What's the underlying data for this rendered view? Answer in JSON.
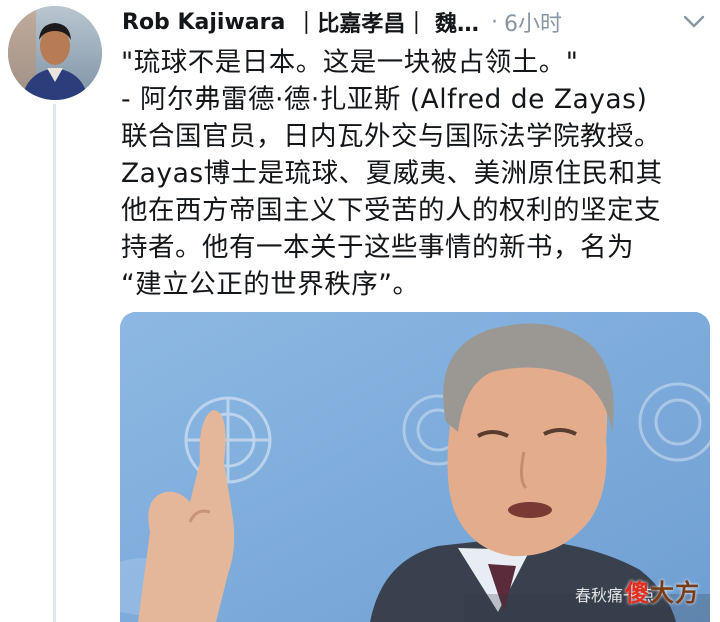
{
  "tweet": {
    "author_name": "Rob Kajiwara",
    "author_handle": "｜比嘉孝昌｜ 魏…",
    "separator": "·",
    "time": "6小时",
    "lines": [
      "\"琉球不是日本。这是一块被占领土。\"",
      "- 阿尔弗雷德·德·扎亚斯 (Alfred de Zayas)",
      "联合国官员，日内瓦外交与国际法学院教授。",
      "Zayas博士是琉球、夏威夷、美洲原住民和其",
      "他在西方帝国主义下受苦的人的权利的坚定支",
      "持者。他有一本关于这些事情的新书，名为",
      "“建立公正的世界秩序”。"
    ]
  },
  "watermark": {
    "sub_text": "春秋痛一点",
    "char1": "傻",
    "char2": "大方"
  },
  "colors": {
    "text": "#14171a",
    "muted": "#8a96a3",
    "thread_line": "#e1e8ed",
    "un_blue": "#7aa9d9",
    "watermark_red": "#e32b1e",
    "watermark_brown": "#7a3c16"
  }
}
